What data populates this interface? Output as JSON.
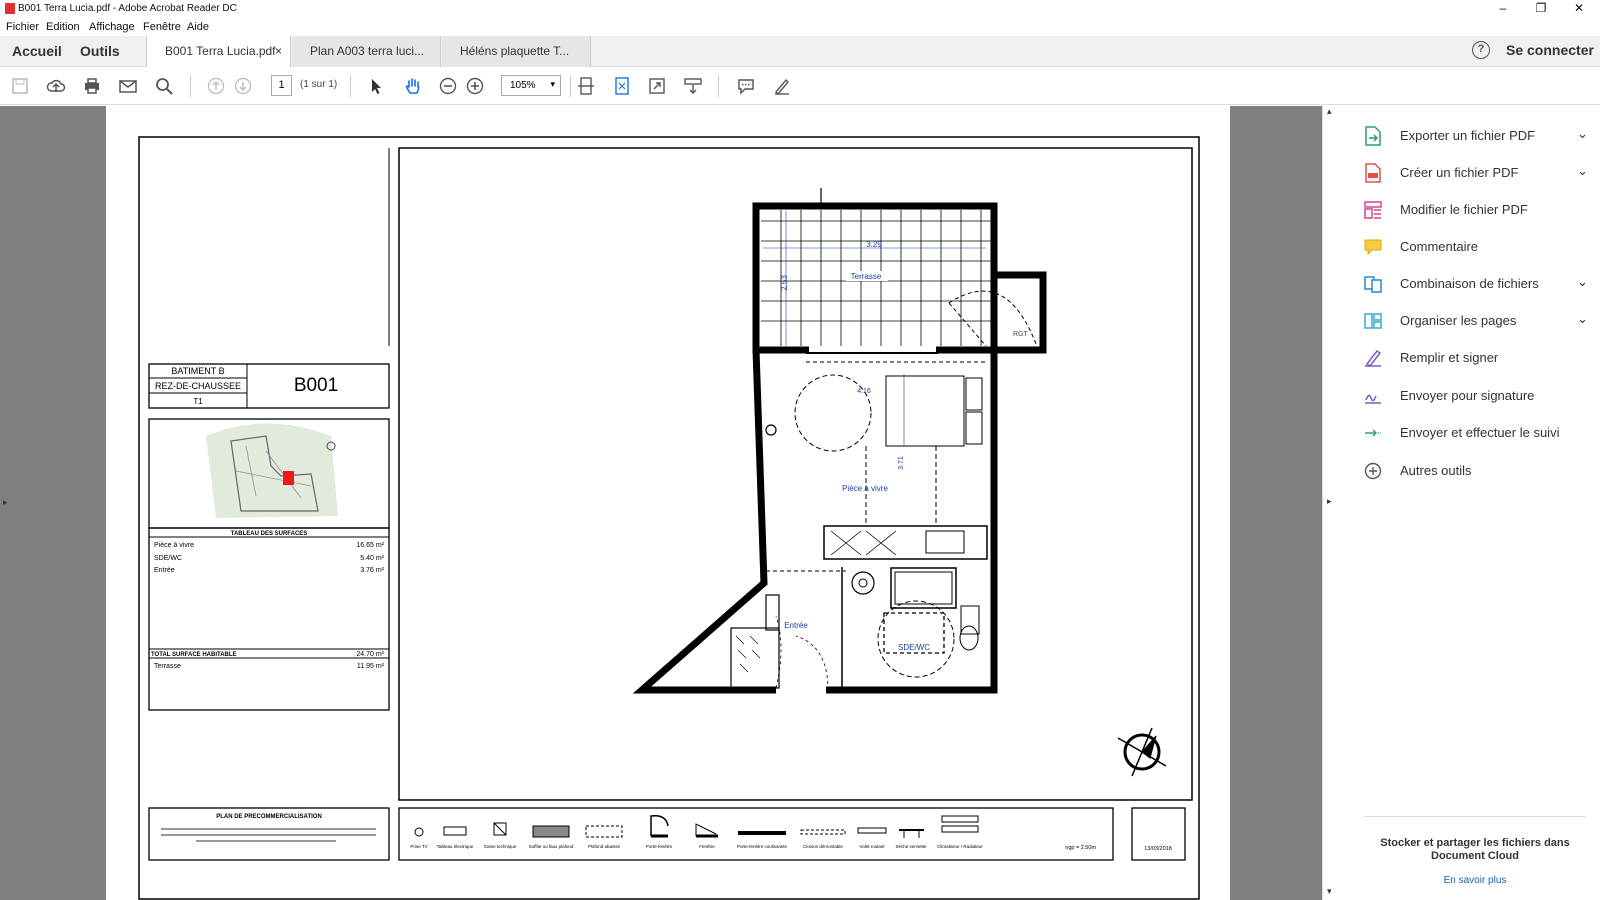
{
  "window": {
    "title": "B001 Terra Lucia.pdf - Adobe Acrobat Reader DC",
    "minimize": "–",
    "restore": "❐",
    "close": "✕"
  },
  "menu": [
    "Fichier",
    "Edition",
    "Affichage",
    "Fenêtre",
    "Aide"
  ],
  "nav": {
    "home": "Accueil",
    "tools": "Outils"
  },
  "tabs": [
    {
      "label": "B001 Terra Lucia.pdf",
      "close": "×"
    },
    {
      "label": "Plan A003 terra luci..."
    },
    {
      "label": "Héléns plaquette T..."
    }
  ],
  "help": "?",
  "connect": "Se connecter",
  "toolbar": {
    "page": "1",
    "of": "(1 sur 1)",
    "zoom": "105%"
  },
  "right_panel": {
    "items": [
      "Exporter un fichier PDF",
      "Créer un fichier PDF",
      "Modifier le fichier PDF",
      "Commentaire",
      "Combinaison de fichiers",
      "Organiser les pages",
      "Remplir et signer",
      "Envoyer pour signature",
      "Envoyer et effectuer le suivi",
      "Autres outils"
    ],
    "cloud_text": "Stocker et partager les fichiers dans Document Cloud",
    "cloud_link": "En savoir plus"
  },
  "plan": {
    "batiment": "BATIMENT B",
    "niveau": "REZ-DE-CHAUSSEE",
    "type": "T1",
    "lot": "B001",
    "surfaces_title": "TABLEAU DES SURFACES",
    "surfaces": [
      {
        "room": "Pièce à vivre",
        "area": "16.65 m²"
      },
      {
        "room": "SDE/WC",
        "area": "5.40 m²"
      },
      {
        "room": "Entrée",
        "area": "3.76 m²"
      }
    ],
    "total_label": "TOTAL SURFACE HABITABLE",
    "total": "24.70 m²",
    "terrace_label": "Terrasse",
    "terrace": "11.95 m²",
    "precom_title": "PLAN DE PRECOMMERCIALISATION",
    "rooms": {
      "terrasse": "Terrasse",
      "piece": "Pièce à vivre",
      "entree": "Entrée",
      "sde": "SDE/WC",
      "rgt": "RGT"
    },
    "dims": {
      "d1": "3.29",
      "d2": "2.53",
      "d3": "4.16",
      "d4": "3.71"
    },
    "legend": [
      "Prise TV",
      "Tableau électrique",
      "Gaine technique",
      "Soffite ou faux plafond",
      "Plafond abaissé",
      "Porte-fenêtre",
      "Fenêtre",
      "Porte-fenêtre coulissante",
      "Cloison démontable",
      "Volet roulant",
      "Sèche serviette",
      "Climatiseur / Radiateur"
    ],
    "scale": "ngp = 2.50m",
    "date": "13/03/2018"
  }
}
